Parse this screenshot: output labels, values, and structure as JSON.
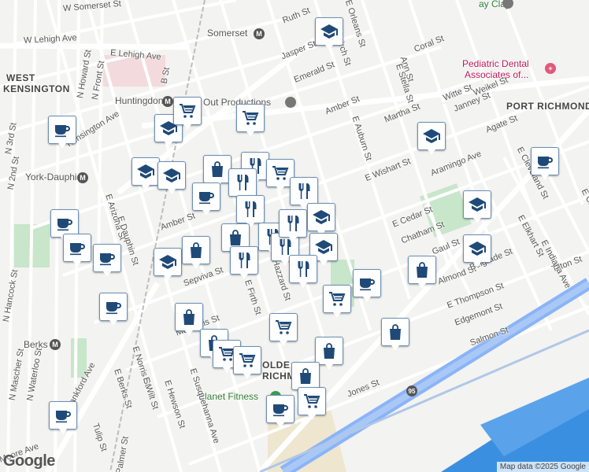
{
  "map": {
    "attribution": "Map data ©2025 Google",
    "google_logo": "Google",
    "area_labels": [
      "WEST",
      "KENSINGTON",
      "PORT RICHMOND",
      "OLDE",
      "RICHMO"
    ],
    "poi_labels": {
      "somerset": "Somerset",
      "huntingdon": "Huntingdon",
      "york_dauphin": "York-Dauphi",
      "berks": "Berks",
      "pediatric_1": "Pediatric Dental",
      "pediatric_2": "Associates of...",
      "out_productions": "Out Productions",
      "planet_fitness": "Planet Fitness",
      "pay_clay": "ay Clay",
      "station_icon": "M",
      "i95": "95"
    },
    "streets": [
      "W Somerset St",
      "W Lehigh Ave",
      "E Lehigh Ave",
      "N Howard St",
      "N Front St",
      "B St",
      "Kensington Ave",
      "N 2nd St",
      "N 3rd St",
      "E Arizona St",
      "E Dauphin St",
      "Amber St",
      "Sepviva St",
      "Memphis St",
      "E Firth St",
      "Hazzard St",
      "E Norris St",
      "E Berks St",
      "E Wilt St",
      "E Hewson St",
      "E Susquehanna Ave",
      "N Mascher St",
      "N Waterloo St",
      "N Hancock St",
      "Frankford Ave",
      "Tulip St",
      "N Palmer St",
      "Aramingo Ave",
      "Almond St",
      "Tilton St",
      "Edgemont St",
      "Salmon St",
      "E Cedar St",
      "Chatham St",
      "Gaul St",
      "E Thompson St",
      "E Cleveland St",
      "E Elkhart St",
      "E Indiana Ave",
      "E Clementine St",
      "Martha St",
      "Witte St",
      "Janney St",
      "Weikel St",
      "Agate St",
      "Coral St",
      "Amber St",
      "Emerald St",
      "Jasper St",
      "Ruth St",
      "E Orleans St",
      "E Birch St",
      "Ann St",
      "E Stella St",
      "E Auburn St",
      "Belgrade St",
      "Moore Ave",
      "E Wishart St",
      "Jones St"
    ],
    "markers": [
      {
        "name": "school-marker",
        "icon": "school"
      },
      {
        "name": "restaurant-marker",
        "icon": "restaurant"
      },
      {
        "name": "grocery-marker",
        "icon": "grocery"
      },
      {
        "name": "shopping-marker",
        "icon": "shopping"
      },
      {
        "name": "cafe-marker",
        "icon": "cafe"
      }
    ]
  }
}
